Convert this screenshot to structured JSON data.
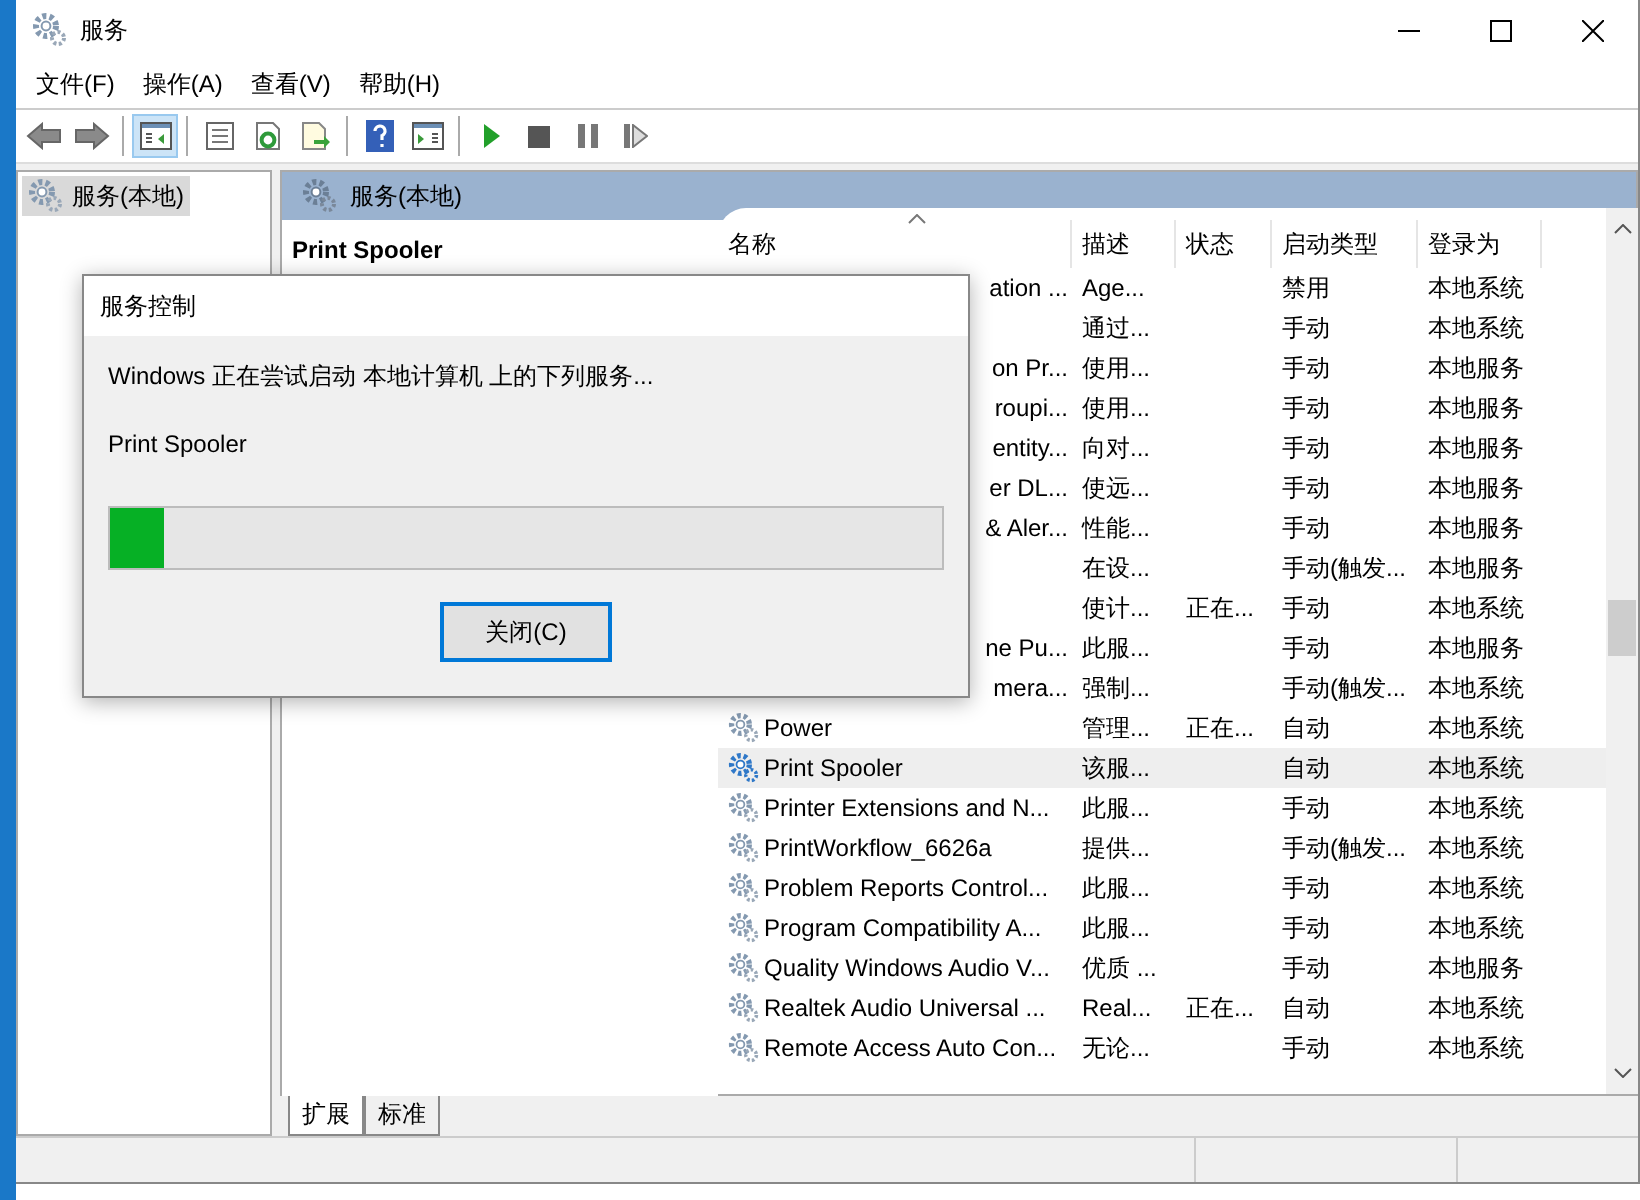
{
  "window": {
    "title": "服务"
  },
  "menu": [
    "文件(F)",
    "操作(A)",
    "查看(V)",
    "帮助(H)"
  ],
  "toolbar": [
    {
      "kind": "back"
    },
    {
      "kind": "forward"
    },
    {
      "kind": "sep"
    },
    {
      "kind": "tree",
      "selected": true
    },
    {
      "kind": "sep"
    },
    {
      "kind": "props"
    },
    {
      "kind": "refresh"
    },
    {
      "kind": "export"
    },
    {
      "kind": "sep"
    },
    {
      "kind": "help"
    },
    {
      "kind": "pane"
    },
    {
      "kind": "sep"
    },
    {
      "kind": "play"
    },
    {
      "kind": "stop"
    },
    {
      "kind": "pause"
    },
    {
      "kind": "resume"
    }
  ],
  "tree": [
    {
      "label": "服务(本地)",
      "selected": true
    }
  ],
  "pane_header": "服务(本地)",
  "detail_title": "Print Spooler",
  "columns": [
    "名称",
    "描述",
    "状态",
    "启动类型",
    "登录为"
  ],
  "rows": [
    {
      "name": "ation ...",
      "icon": false,
      "desc": "Age...",
      "startup": "禁用",
      "logon": "本地系统",
      "selected": false
    },
    {
      "icon": false,
      "desc": "通过...",
      "startup": "手动",
      "logon": "本地系统",
      "selected": false
    },
    {
      "name": "on Pr...",
      "icon": false,
      "desc": "使用...",
      "startup": "手动",
      "logon": "本地服务",
      "selected": false
    },
    {
      "name": "roupi...",
      "icon": false,
      "desc": "使用...",
      "startup": "手动",
      "logon": "本地服务",
      "selected": false
    },
    {
      "name": "entity...",
      "icon": false,
      "desc": "向对...",
      "startup": "手动",
      "logon": "本地服务",
      "selected": false
    },
    {
      "name": "er DL...",
      "icon": false,
      "desc": "使远...",
      "startup": "手动",
      "logon": "本地服务",
      "selected": false
    },
    {
      "name": "& Aler...",
      "icon": false,
      "desc": "性能...",
      "startup": "手动",
      "logon": "本地服务",
      "selected": false
    },
    {
      "icon": false,
      "desc": "在设...",
      "startup": "手动(触发...",
      "logon": "本地服务",
      "selected": false
    },
    {
      "icon": false,
      "desc": "使计...",
      "status": "正在...",
      "startup": "手动",
      "logon": "本地系统",
      "selected": false
    },
    {
      "name": "ne Pu...",
      "icon": false,
      "desc": "此服...",
      "startup": "手动",
      "logon": "本地服务",
      "selected": false
    },
    {
      "name": "mera...",
      "icon": false,
      "desc": "强制...",
      "startup": "手动(触发...",
      "logon": "本地系统",
      "selected": false
    },
    {
      "name": "Power",
      "icon": true,
      "desc": "管理...",
      "status": "正在...",
      "startup": "自动",
      "logon": "本地系统",
      "selected": false
    },
    {
      "name": "Print Spooler",
      "icon": true,
      "desc": "该服...",
      "startup": "自动",
      "logon": "本地系统",
      "selected": true
    },
    {
      "name": "Printer Extensions and N...",
      "icon": true,
      "desc": "此服...",
      "startup": "手动",
      "logon": "本地系统",
      "selected": false
    },
    {
      "name": "PrintWorkflow_6626a",
      "icon": true,
      "desc": "提供...",
      "startup": "手动(触发...",
      "logon": "本地系统",
      "selected": false
    },
    {
      "name": "Problem Reports Control...",
      "icon": true,
      "desc": "此服...",
      "startup": "手动",
      "logon": "本地系统",
      "selected": false
    },
    {
      "name": "Program Compatibility A...",
      "icon": true,
      "desc": "此服...",
      "startup": "手动",
      "logon": "本地系统",
      "selected": false
    },
    {
      "name": "Quality Windows Audio V...",
      "icon": true,
      "desc": "优质 ...",
      "startup": "手动",
      "logon": "本地服务",
      "selected": false
    },
    {
      "name": "Realtek Audio Universal ...",
      "icon": true,
      "desc": "Real...",
      "status": "正在...",
      "startup": "自动",
      "logon": "本地系统",
      "selected": false
    },
    {
      "name": "Remote Access Auto Con...",
      "icon": true,
      "desc": "无论...",
      "startup": "手动",
      "logon": "本地系统",
      "selected": false
    }
  ],
  "tabs": [
    {
      "label": "扩展",
      "selected": true
    },
    {
      "label": "标准",
      "selected": false
    }
  ],
  "dialog": {
    "title": "服务控制",
    "message": "Windows 正在尝试启动 本地计算机 上的下列服务...",
    "service": "Print Spooler",
    "level": 0.065,
    "button": "关闭(C)"
  }
}
